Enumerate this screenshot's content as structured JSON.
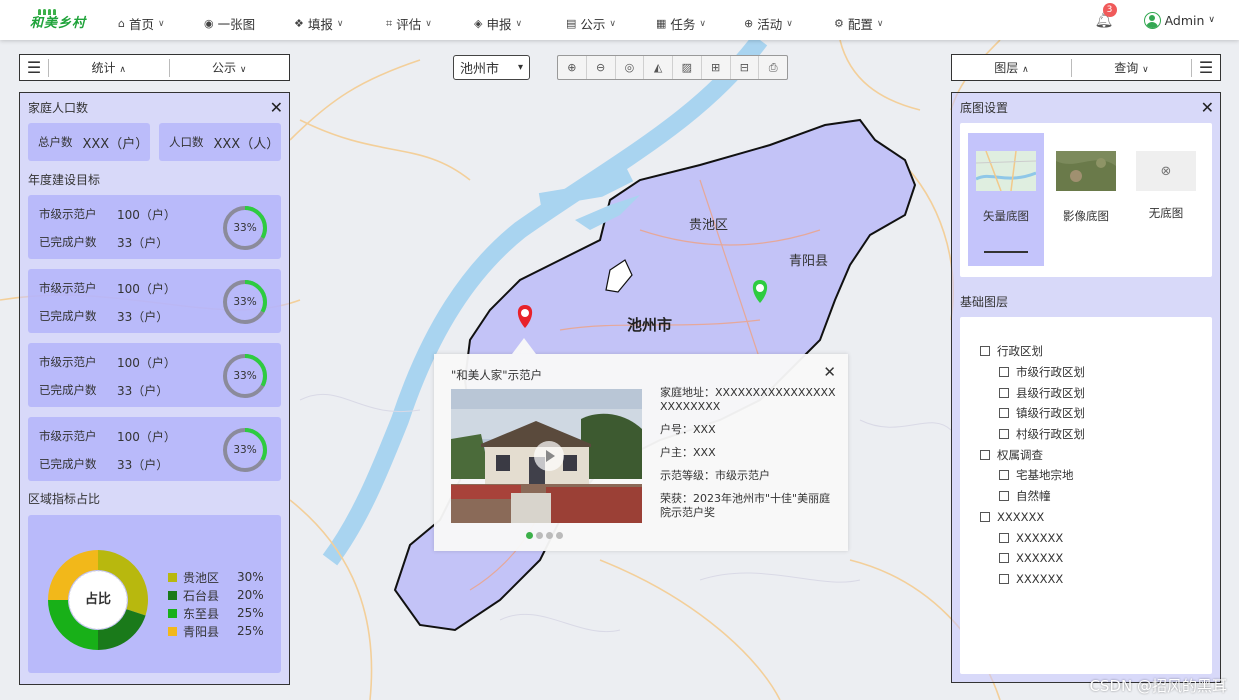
{
  "logo": {
    "text": "和美乡村"
  },
  "nav": [
    {
      "icon": "home-icon",
      "glyph": "⌂",
      "label": "首页",
      "chev": true
    },
    {
      "icon": "globe-icon",
      "glyph": "◉",
      "label": "一张图",
      "chev": false
    },
    {
      "icon": "cubes-icon",
      "glyph": "❖",
      "label": "填报",
      "chev": true
    },
    {
      "icon": "assess-icon",
      "glyph": "⌗",
      "label": "评估",
      "chev": true
    },
    {
      "icon": "layers-icon",
      "glyph": "◈",
      "label": "申报",
      "chev": true
    },
    {
      "icon": "notice-icon",
      "glyph": "▤",
      "label": "公示",
      "chev": true
    },
    {
      "icon": "task-icon",
      "glyph": "▦",
      "label": "任务",
      "chev": true
    },
    {
      "icon": "activity-icon",
      "glyph": "⊕",
      "label": "活动",
      "chev": true
    },
    {
      "icon": "config-icon",
      "glyph": "⚙",
      "label": "配置",
      "chev": true
    }
  ],
  "notifications": {
    "count": "3"
  },
  "user": {
    "name": "Admin"
  },
  "left_toolbar": {
    "stats": "统计",
    "notice": "公示"
  },
  "right_toolbar": {
    "layers": "图层",
    "query": "查询"
  },
  "city_select": {
    "value": "池州市"
  },
  "map_labels": {
    "city": "池州市",
    "district1": "贵池区",
    "district2": "青阳县"
  },
  "left_panel": {
    "title": "家庭人口数",
    "households_label": "总户数",
    "households_value": "XXX（户）",
    "population_label": "人口数",
    "population_value": "XXX（人）",
    "goals_title": "年度建设目标",
    "goals": [
      {
        "k1": "市级示范户",
        "v1": "100（户）",
        "k2": "已完成户数",
        "v2": "33（户）",
        "pct": "33%",
        "fraction": 0.33
      },
      {
        "k1": "市级示范户",
        "v1": "100（户）",
        "k2": "已完成户数",
        "v2": "33（户）",
        "pct": "33%",
        "fraction": 0.33
      },
      {
        "k1": "市级示范户",
        "v1": "100（户）",
        "k2": "已完成户数",
        "v2": "33（户）",
        "pct": "33%",
        "fraction": 0.33
      },
      {
        "k1": "市级示范户",
        "v1": "100（户）",
        "k2": "已完成户数",
        "v2": "33（户）",
        "pct": "33%",
        "fraction": 0.33
      }
    ],
    "region_title": "区域指标占比",
    "donut_label": "占比",
    "regions": [
      {
        "name": "贵池区",
        "pct": "30%",
        "value": 30,
        "color": "#b8b80e"
      },
      {
        "name": "石台县",
        "pct": "20%",
        "value": 20,
        "color": "#1a7a1a"
      },
      {
        "name": "东至县",
        "pct": "25%",
        "value": 25,
        "color": "#18b018"
      },
      {
        "name": "青阳县",
        "pct": "25%",
        "value": 25,
        "color": "#f2b81a"
      }
    ]
  },
  "popup": {
    "title": "\"和美人家\"示范户",
    "address": "家庭地址：XXXXXXXXXXXXXXXXXXXXXXXX",
    "household_no": "户号：XXX",
    "owner": "户主：XXX",
    "level": "示范等级：市级示范户",
    "award": "荣获：2023年池州市\"十佳\"美丽庭院示范户奖"
  },
  "right_panel": {
    "base_title": "底图设置",
    "base_options": [
      {
        "label": "矢量底图",
        "selected": true
      },
      {
        "label": "影像底图",
        "selected": false
      },
      {
        "label": "无底图",
        "selected": false
      }
    ],
    "layers_title": "基础图层",
    "tree": [
      {
        "label": "行政区划",
        "sub": false
      },
      {
        "label": "市级行政区划",
        "sub": true
      },
      {
        "label": "县级行政区划",
        "sub": true
      },
      {
        "label": "镇级行政区划",
        "sub": true
      },
      {
        "label": "村级行政区划",
        "sub": true
      },
      {
        "label": "权属调查",
        "sub": false
      },
      {
        "label": "宅基地宗地",
        "sub": true
      },
      {
        "label": "自然幢",
        "sub": true
      },
      {
        "label": "XXXXXX",
        "sub": false
      },
      {
        "label": "XXXXXX",
        "sub": true
      },
      {
        "label": "XXXXXX",
        "sub": true
      },
      {
        "label": "XXXXXX",
        "sub": true
      }
    ]
  },
  "watermark": "CSDN @招风的黑耳"
}
